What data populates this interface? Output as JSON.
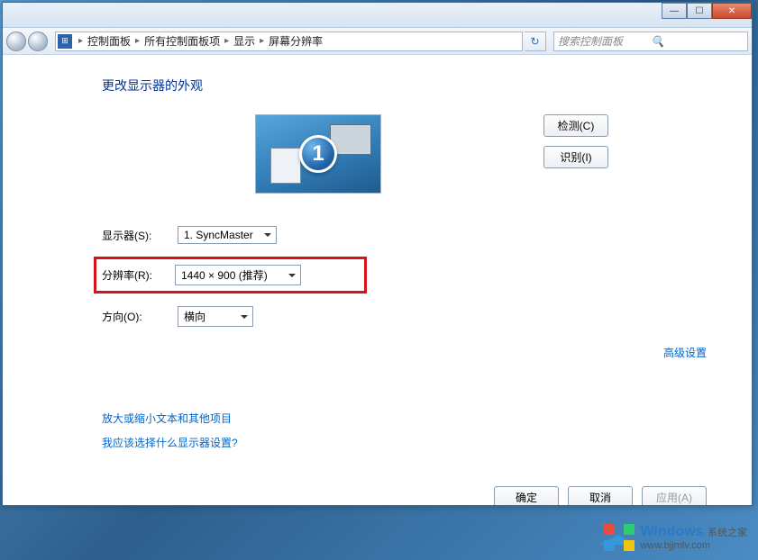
{
  "titlebar": {
    "minimize": "—",
    "maximize": "☐",
    "close": "✕"
  },
  "breadcrumb": {
    "items": [
      "控制面板",
      "所有控制面板项",
      "显示",
      "屏幕分辨率"
    ],
    "sep": "▸"
  },
  "search": {
    "placeholder": "搜索控制面板"
  },
  "heading": "更改显示器的外观",
  "monitor": {
    "number": "1"
  },
  "buttons": {
    "detect": "检测(C)",
    "identify": "识别(I)"
  },
  "form": {
    "display_label": "显示器(S):",
    "display_value": "1. SyncMaster",
    "resolution_label": "分辨率(R):",
    "resolution_value": "1440 × 900 (推荐)",
    "orientation_label": "方向(O):",
    "orientation_value": "横向"
  },
  "links": {
    "advanced": "高级设置",
    "textsize": "放大或缩小文本和其他项目",
    "whichdisplay": "我应该选择什么显示器设置?"
  },
  "dialog": {
    "ok": "确定",
    "cancel": "取消",
    "apply": "应用(A)"
  },
  "watermark": {
    "brand": "Windows",
    "sub1": "系统之家",
    "sub2": "www.bjjmlv.com"
  }
}
